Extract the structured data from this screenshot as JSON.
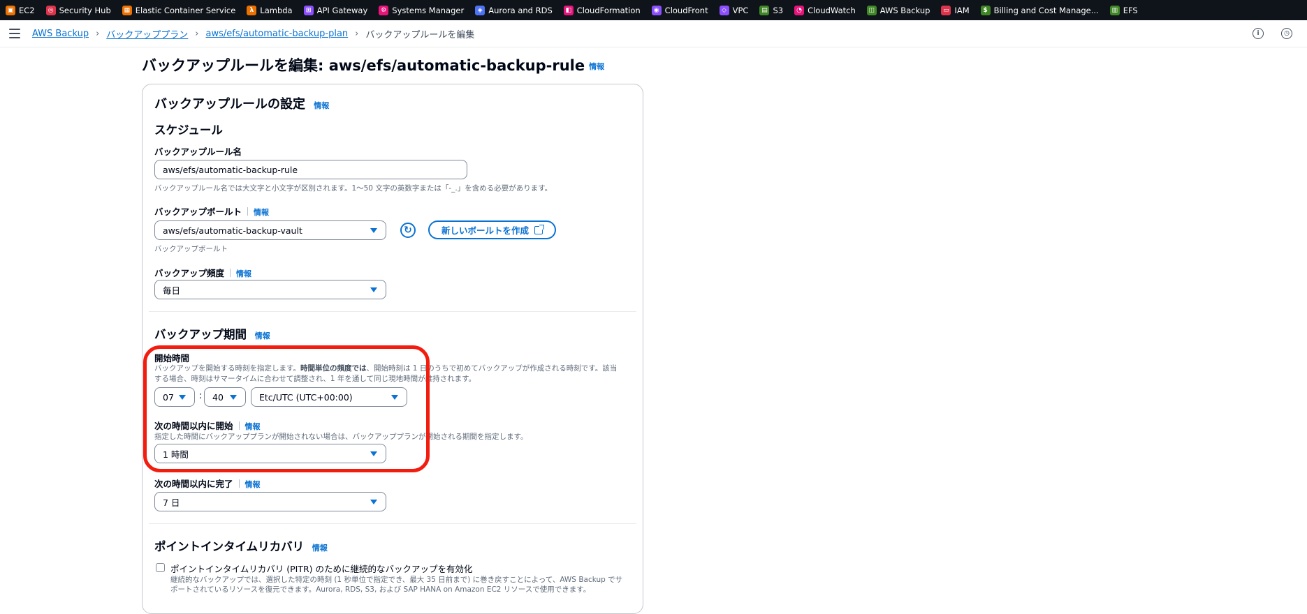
{
  "services": [
    {
      "label": "EC2",
      "icon": "ec2-icon",
      "color": "#ed7100"
    },
    {
      "label": "Security Hub",
      "icon": "security-hub-icon",
      "color": "#dd344c"
    },
    {
      "label": "Elastic Container Service",
      "icon": "ecs-icon",
      "color": "#ed7100"
    },
    {
      "label": "Lambda",
      "icon": "lambda-icon",
      "color": "#ed7100"
    },
    {
      "label": "API Gateway",
      "icon": "api-gateway-icon",
      "color": "#8c4fff"
    },
    {
      "label": "Systems Manager",
      "icon": "systems-manager-icon",
      "color": "#e7157b"
    },
    {
      "label": "Aurora and RDS",
      "icon": "rds-icon",
      "color": "#4d72f3"
    },
    {
      "label": "CloudFormation",
      "icon": "cloudformation-icon",
      "color": "#e7157b"
    },
    {
      "label": "CloudFront",
      "icon": "cloudfront-icon",
      "color": "#8c4fff"
    },
    {
      "label": "VPC",
      "icon": "vpc-icon",
      "color": "#8c4fff"
    },
    {
      "label": "S3",
      "icon": "s3-icon",
      "color": "#3f8624"
    },
    {
      "label": "CloudWatch",
      "icon": "cloudwatch-icon",
      "color": "#e7157b"
    },
    {
      "label": "AWS Backup",
      "icon": "aws-backup-icon",
      "color": "#3f8624"
    },
    {
      "label": "IAM",
      "icon": "iam-icon",
      "color": "#dd344c"
    },
    {
      "label": "Billing and Cost Manage...",
      "icon": "billing-icon",
      "color": "#3f8624"
    },
    {
      "label": "EFS",
      "icon": "efs-icon",
      "color": "#3f8624"
    }
  ],
  "breadcrumb": {
    "items": [
      "AWS Backup",
      "バックアッププラン",
      "aws/efs/automatic-backup-plan"
    ],
    "current": "バックアップルールを編集",
    "separator": "›"
  },
  "page": {
    "title": "バックアップルールを編集: aws/efs/automatic-backup-rule",
    "info": "情報"
  },
  "settings": {
    "heading": "バックアップルールの設定",
    "info": "情報",
    "schedule_heading": "スケジュール",
    "rule_name": {
      "label": "バックアップルール名",
      "value": "aws/efs/automatic-backup-rule",
      "hint": "バックアップルール名では大文字と小文字が区別されます。1〜50 文字の英数字または「-_.」を含める必要があります。"
    },
    "vault": {
      "label": "バックアップボールト",
      "info": "情報",
      "value": "aws/efs/automatic-backup-vault",
      "hint": "バックアップボールト",
      "create_button": "新しいボールトを作成"
    },
    "frequency": {
      "label": "バックアップ頻度",
      "info": "情報",
      "value": "毎日"
    }
  },
  "window": {
    "heading": "バックアップ期間",
    "info": "情報",
    "start_time": {
      "label": "開始時間",
      "desc_pre": "バックアップを開始する時刻を指定します。",
      "desc_bold": "時間単位の頻度では",
      "desc_post": "、開始時刻は 1 日のうちで初めてバックアップが作成される時刻です。該当",
      "desc_line2": "する場合、時刻はサマータイムに合わせて調整され、1 年を通して同じ現地時間が維持されます。",
      "hour": "07",
      "colon": ":",
      "minute": "40",
      "timezone": "Etc/UTC (UTC+00:00)"
    },
    "start_within": {
      "label": "次の時間以内に開始",
      "info": "情報",
      "desc": "指定した時間にバックアッププランが開始されない場合は、バックアッププランが開始される期間を指定します。",
      "value": "1 時間"
    },
    "complete_within": {
      "label": "次の時間以内に完了",
      "info": "情報",
      "value": "7 日"
    }
  },
  "pitr": {
    "heading": "ポイントインタイムリカバリ",
    "info": "情報",
    "checkbox_label": "ポイントインタイムリカバリ (PITR) のために継続的なバックアップを有効化",
    "checked": false,
    "desc_line1": "継続的なバックアップでは、選択した特定の時刻 (1 秒単位で指定でき、最大 35 日前まで) に巻き戻すことによって、AWS Backup でサ",
    "desc_line2": "ポートされているリソースを復元できます。Aurora, RDS, S3, および SAP HANA on Amazon EC2 リソースで使用できます。"
  },
  "colors": {
    "link": "#0972d3",
    "highlight": "#f21d0f",
    "topbar": "#0f141a"
  }
}
